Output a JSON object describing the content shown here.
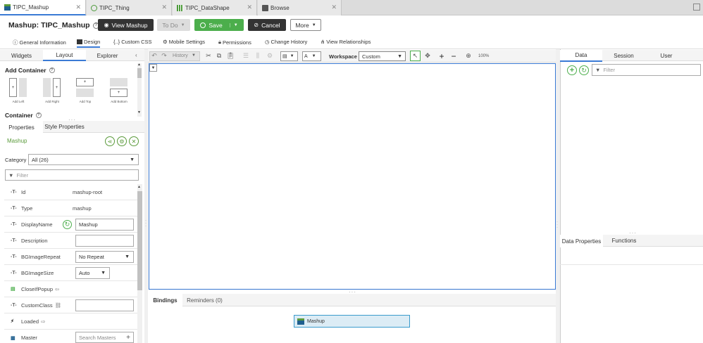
{
  "tabs": [
    {
      "label": "TIPC_Mashup",
      "icon": "mashup-icon"
    },
    {
      "label": "TIPC_Thing",
      "icon": "thing-icon"
    },
    {
      "label": "TIPC_DataShape",
      "icon": "datashape-icon"
    },
    {
      "label": "Browse",
      "icon": "folder-icon"
    }
  ],
  "header": {
    "prefix": "Mashup:",
    "name": "TIPC_Mashup",
    "view_label": "View Mashup",
    "todo_label": "To Do",
    "save_label": "Save",
    "cancel_label": "Cancel",
    "more_label": "More"
  },
  "subnav": [
    "General Information",
    "Design",
    "Custom CSS",
    "Mobile Settings",
    "Permissions",
    "Change History",
    "View Relationships"
  ],
  "left_tabs": {
    "widgets": "Widgets",
    "layout": "Layout",
    "explorer": "Explorer"
  },
  "add_container": {
    "title": "Add Container",
    "items": [
      "Add Left",
      "Add Right",
      "Add Top",
      "Add Bottom"
    ],
    "container_title": "Container"
  },
  "props_tabs": {
    "properties": "Properties",
    "style": "Style Properties"
  },
  "props": {
    "widget_name": "Mashup",
    "category_label": "Category",
    "category_value": "All (26)",
    "filter_placeholder": "Filter",
    "rows": [
      {
        "label": "Id",
        "value": "mashup-root"
      },
      {
        "label": "Type",
        "value": "mashup"
      },
      {
        "label": "DisplayName",
        "value": "Mashup"
      },
      {
        "label": "Description",
        "value": ""
      },
      {
        "label": "BGImageRepeat",
        "value": "No Repeat"
      },
      {
        "label": "BGImageSize",
        "value": "Auto"
      },
      {
        "label": "CloseIfPopup",
        "value": ""
      },
      {
        "label": "CustomClass",
        "value": ""
      },
      {
        "label": "Loaded",
        "value": ""
      },
      {
        "label": "Master",
        "value": "Search Masters"
      }
    ]
  },
  "toolbar": {
    "history_label": "History",
    "workspace_label": "Workspace",
    "workspace_value": "Custom",
    "zoom": "100%"
  },
  "bottom_tabs": {
    "bindings": "Bindings",
    "reminders": "Reminders (0)"
  },
  "binding_node": "Mashup",
  "right_tabs": {
    "data": "Data",
    "session": "Session",
    "user": "User"
  },
  "right_filter_placeholder": "Filter",
  "right_bottom_tabs": {
    "data_properties": "Data Properties",
    "functions": "Functions"
  },
  "colors": {
    "accent": "#3a7ad5",
    "save": "#4cae4c",
    "dark_button": "#333333",
    "mashup_green": "#5a9a3a"
  }
}
